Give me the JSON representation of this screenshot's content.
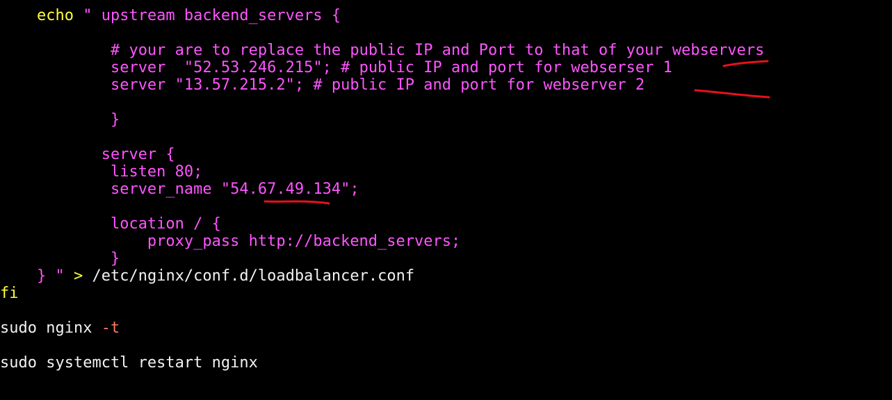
{
  "script": {
    "echo_line": {
      "keyword": "echo",
      "open_quote": " \"",
      "rest": " upstream backend_servers {"
    },
    "comment_line": "# your are to replace the public IP and Port to that of your webservers",
    "server1_line": "server  \"52.53.246.215\"; # public IP and port for webserser 1",
    "server2_line": "server \"13.57.215.2\"; # public IP and port for webserver 2",
    "upstream_close": "}",
    "server_block_open": "server {",
    "listen_line": "listen 80;",
    "server_name_line": "server_name \"54.67.49.134\";",
    "location_line": "location / {",
    "proxy_pass_line": "proxy_pass http://backend_servers;",
    "location_close": "}",
    "echo_end": {
      "close_brace_quote": "} \"",
      "redirect": " > ",
      "path": "/etc/nginx/conf.d/loadbalancer.conf"
    },
    "fi_line": "fi",
    "nginx_test": {
      "command": "sudo nginx ",
      "flag": "-t"
    },
    "restart_line": "sudo systemctl restart nginx"
  },
  "colors": {
    "background": "#000000",
    "keyword_yellow": "#ffff3c",
    "string_pink": "#ff55ff",
    "plain_white": "#f2f2f2",
    "flag_salmon": "#ff7b63",
    "annotation_red": "#e8101c"
  },
  "annotations": [
    "red underline beside webserser 1",
    "red underline beside webserver 2",
    "red underline under 54.67.49.134"
  ]
}
